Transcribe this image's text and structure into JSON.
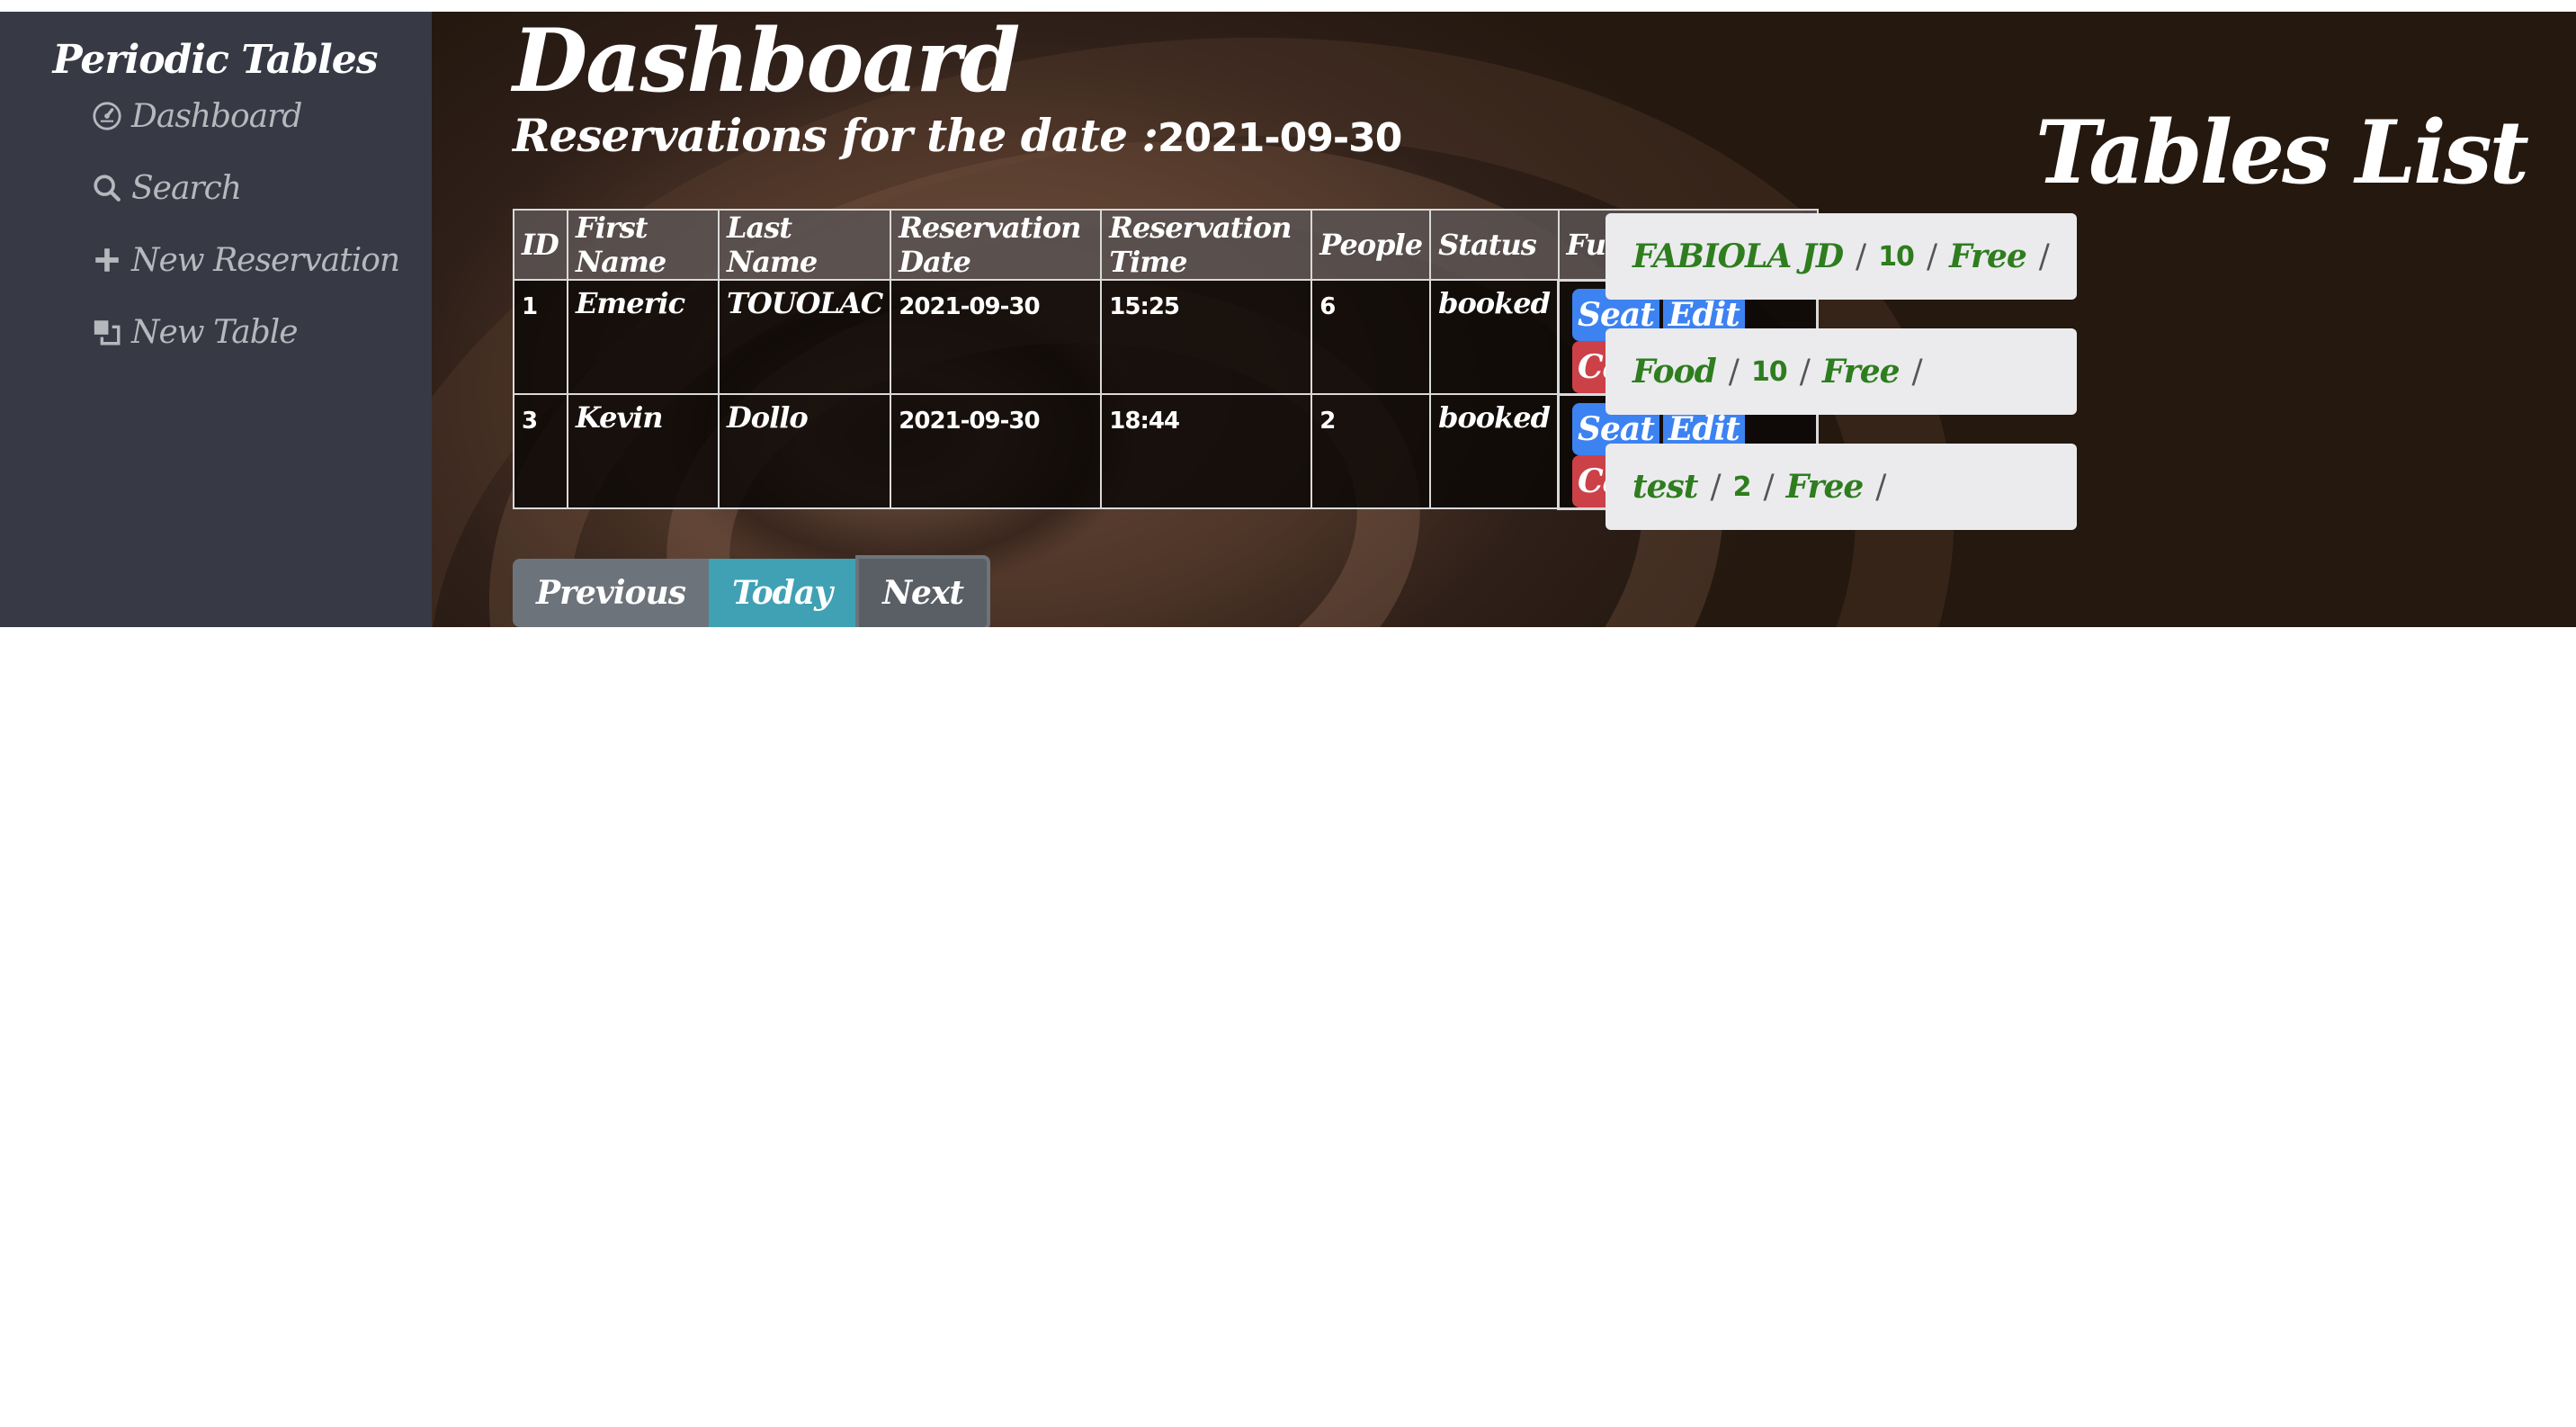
{
  "sidebar": {
    "brand": "Periodic Tables",
    "items": [
      {
        "label": "Dashboard",
        "icon": "dashboard-gauge-icon"
      },
      {
        "label": "Search",
        "icon": "search-icon"
      },
      {
        "label": "New Reservation",
        "icon": "plus-icon"
      },
      {
        "label": "New Table",
        "icon": "table-icon"
      }
    ]
  },
  "main": {
    "title": "Dashboard",
    "subtitle_prefix": "Reservations for the date :",
    "subtitle_date": "2021-09-30",
    "table": {
      "headers": [
        "ID",
        "First Name",
        "Last Name",
        "Reservation Date",
        "Reservation Time",
        "People",
        "Status",
        "Functions"
      ],
      "rows": [
        {
          "id": "1",
          "first_name": "Emeric",
          "last_name": "TOUOLAC",
          "date": "2021-09-30",
          "time": "15:25",
          "people": "6",
          "status": "booked"
        },
        {
          "id": "3",
          "first_name": "Kevin",
          "last_name": "Dollo",
          "date": "2021-09-30",
          "time": "18:44",
          "people": "2",
          "status": "booked"
        }
      ],
      "actions": {
        "seat": "Seat",
        "edit": "Edit",
        "cancel": "Cancel"
      }
    },
    "pager": {
      "previous": "Previous",
      "today": "Today",
      "next": "Next"
    }
  },
  "tables_list": {
    "title": "Tables List :",
    "separator": "/",
    "items": [
      {
        "name": "FABIOLA JD",
        "capacity": "10",
        "status": "Free"
      },
      {
        "name": "Food",
        "capacity": "10",
        "status": "Free"
      },
      {
        "name": "test",
        "capacity": "2",
        "status": "Free"
      }
    ]
  },
  "colors": {
    "sidebar_bg": "#373a45",
    "seat_edit_button": "#3d82f1",
    "cancel_button": "#cc4148",
    "today_button": "#3fa1b3",
    "table_status_text": "#2e7d1e"
  }
}
